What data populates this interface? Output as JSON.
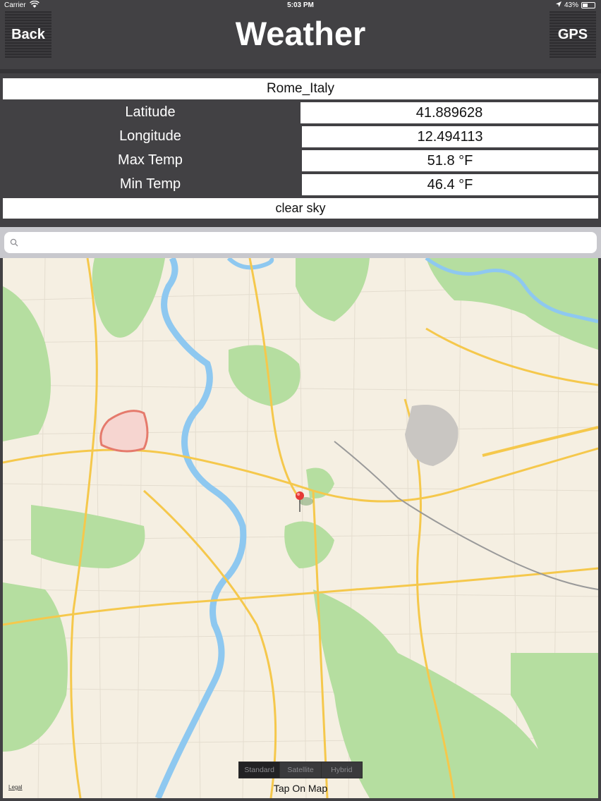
{
  "status_bar": {
    "carrier": "Carrier",
    "time": "5:03 PM",
    "battery": "43%",
    "battery_level": 0.43
  },
  "navbar": {
    "title": "Weather",
    "back_label": "Back",
    "gps_label": "GPS"
  },
  "weather": {
    "location": "Rome_Italy",
    "rows": [
      {
        "label": "Latitude",
        "value": "41.889628"
      },
      {
        "label": "Longitude",
        "value": "12.494113"
      },
      {
        "label": "Max Temp",
        "value": "51.8 °F"
      },
      {
        "label": "Min Temp",
        "value": "46.4 °F"
      }
    ],
    "description": "clear sky"
  },
  "search": {
    "value": "",
    "placeholder": ""
  },
  "map": {
    "map_types": [
      "Standard",
      "Satellite",
      "Hybrid"
    ],
    "selected_type": "Standard",
    "legal": "Legal",
    "hint": "Tap On Map",
    "colors": {
      "land": "#f5efe2",
      "park": "#a8d990",
      "river": "#8ec8f0",
      "major_road": "#f4c542",
      "minor_road": "#ffffff",
      "pin": "#e53935"
    }
  }
}
